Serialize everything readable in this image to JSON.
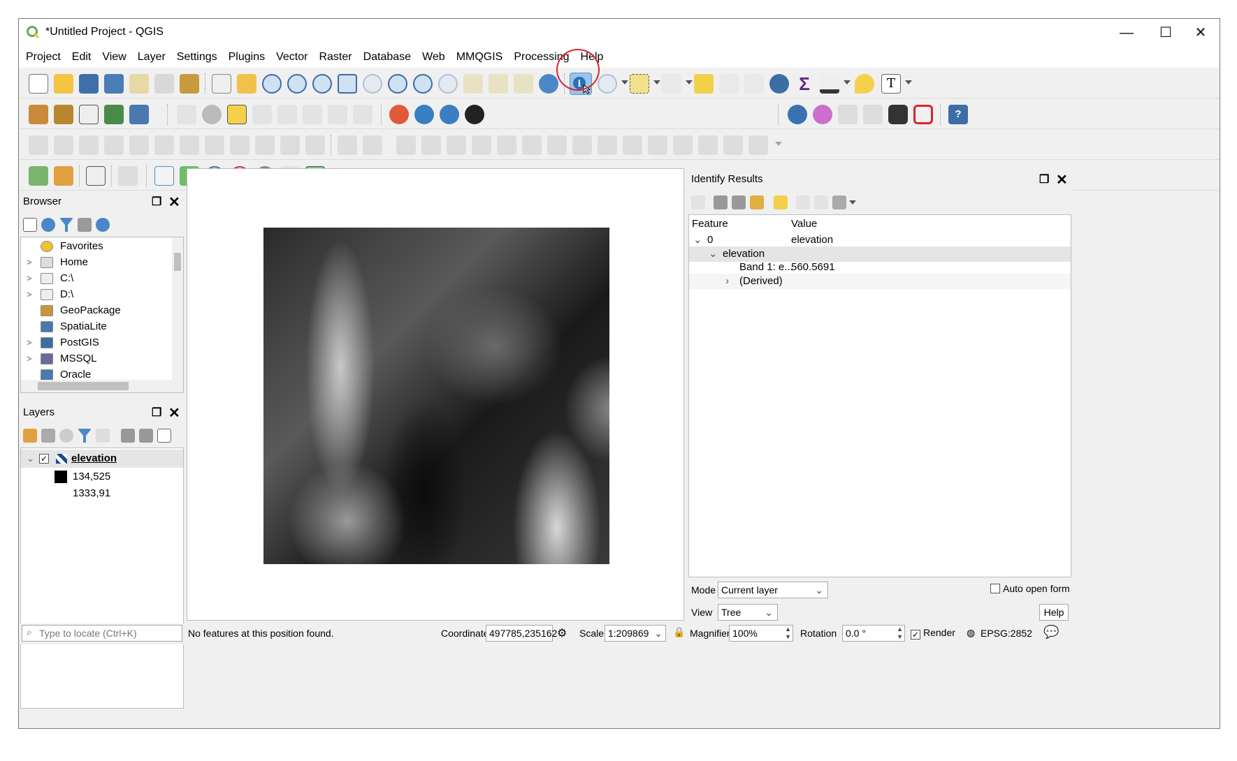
{
  "window": {
    "title": "*Untitled Project - QGIS",
    "minimize": "—",
    "maximize": "☐",
    "close": "✕"
  },
  "menu": [
    "Project",
    "Edit",
    "View",
    "Layer",
    "Settings",
    "Plugins",
    "Vector",
    "Raster",
    "Database",
    "Web",
    "MMQGIS",
    "Processing",
    "Help"
  ],
  "browser": {
    "title": "Browser",
    "items": [
      {
        "label": "Favorites",
        "arrow": "",
        "icon": "star-icon"
      },
      {
        "label": "Home",
        "arrow": ">",
        "icon": "home-folder-icon"
      },
      {
        "label": "C:\\",
        "arrow": ">",
        "icon": "folder-icon"
      },
      {
        "label": "D:\\",
        "arrow": ">",
        "icon": "folder-icon"
      },
      {
        "label": "GeoPackage",
        "arrow": "",
        "icon": "geopackage-icon"
      },
      {
        "label": "SpatiaLite",
        "arrow": "",
        "icon": "spatialite-icon"
      },
      {
        "label": "PostGIS",
        "arrow": ">",
        "icon": "postgis-icon"
      },
      {
        "label": "MSSQL",
        "arrow": ">",
        "icon": "mssql-icon"
      },
      {
        "label": "Oracle",
        "arrow": "",
        "icon": "oracle-icon"
      }
    ]
  },
  "layers": {
    "title": "Layers",
    "layer_name": "elevation",
    "legend_min": "134,525",
    "legend_max": "1333,91"
  },
  "identify": {
    "title": "Identify Results",
    "col_feature": "Feature",
    "col_value": "Value",
    "rows": {
      "feature_id": "0",
      "feature_value": "elevation",
      "layer": "elevation",
      "band_label": "Band 1: e...",
      "band_value": "560.5691",
      "derived": "(Derived)"
    },
    "mode_label": "Mode",
    "mode_value": "Current layer",
    "view_label": "View",
    "view_value": "Tree",
    "auto_open": "Auto open form",
    "help": "Help"
  },
  "status": {
    "locate_placeholder": "Type to locate (Ctrl+K)",
    "message": "No features at this position found.",
    "coordinate_label": "Coordinate",
    "coordinate_value": "497785,235162",
    "scale_label": "Scale",
    "scale_value": "1:209869",
    "magnifier_label": "Magnifier",
    "magnifier_value": "100%",
    "rotation_label": "Rotation",
    "rotation_value": "0.0 °",
    "render_label": "Render",
    "crs": "EPSG:2852"
  },
  "colors": {
    "highlight_circle": "#d9232f",
    "accent": "#2a6fb7"
  }
}
